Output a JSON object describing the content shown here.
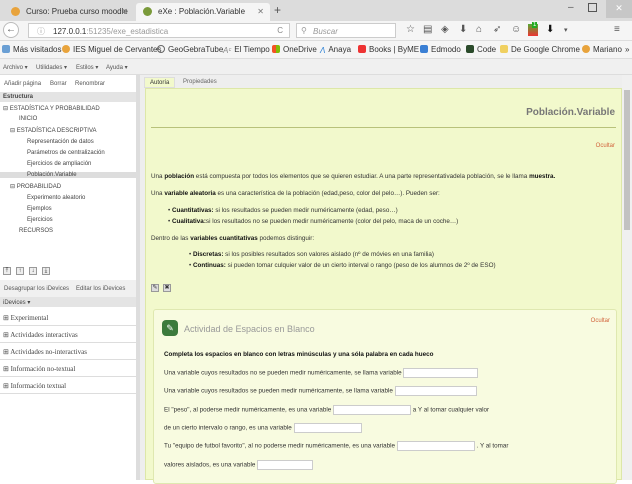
{
  "browser": {
    "tabs": [
      {
        "label": "Curso: Prueba curso moodle",
        "active": false
      },
      {
        "label": "eXe : Población.Variable",
        "active": true
      }
    ],
    "url_host": "127.0.0.1",
    "url_rest": ":51235/exe_estadistica",
    "search_placeholder": "Buscar",
    "badge_count": "1",
    "bookmarks": [
      "Más visitados",
      "IES Miguel de Cervantes",
      "GeoGebraTube",
      "El Tiempo",
      "OneDrive",
      "Anaya",
      "Books | ByME",
      "Edmodo",
      "Code",
      "De Google Chrome",
      "Mariano"
    ],
    "overflow": "»"
  },
  "menu": [
    "Archivo ▾",
    "Utilidades ▾",
    "Estilos ▾",
    "Ayuda ▾"
  ],
  "left": {
    "toolbar": [
      "Añadir página",
      "Borrar",
      "Renombrar"
    ],
    "structure_title": "Estructura",
    "tree": [
      {
        "label": "ESTADÍSTICA Y PROBABILIDAD",
        "level": 0,
        "toggle": "⊟"
      },
      {
        "label": "INICIO",
        "level": 1
      },
      {
        "label": "ESTADÍSTICA DESCRIPTIVA",
        "level": 1,
        "toggle": "⊟"
      },
      {
        "label": "Representación de datos",
        "level": 2
      },
      {
        "label": "Parámetros de centralización",
        "level": 2
      },
      {
        "label": "Ejercicios de ampliación",
        "level": 2
      },
      {
        "label": "Población.Variable",
        "level": 2,
        "selected": true
      },
      {
        "label": "PROBABILIDAD",
        "level": 1,
        "toggle": "⊟"
      },
      {
        "label": "Experimento aleatorio",
        "level": 2
      },
      {
        "label": "Ejemplos",
        "level": 2
      },
      {
        "label": "Ejercicios",
        "level": 2
      },
      {
        "label": "RECURSOS",
        "level": 1
      }
    ],
    "idevice_actions": [
      "Desagrupar los iDevices",
      "Editar los iDevices"
    ],
    "idevices_title": "iDevices ▾",
    "idevice_groups": [
      "Experimental",
      "Actividades interactivas",
      "Actividades no-interactivas",
      "Información no-textual",
      "Información textual"
    ]
  },
  "main": {
    "tabs": [
      "Autoría",
      "Propiedades"
    ],
    "page_title": "Población.Variable",
    "hide": "Ocultar",
    "p1": {
      "a": "Una ",
      "b": "población",
      "c": " está compuesta por todos los elementos que se quieren estudiar. A una parte representativadela población, se le llama ",
      "d": "muestra."
    },
    "p2": {
      "a": "Una ",
      "b": "variable aleatoria",
      "c": " es una característica de la población (edad,peso, color del pelo…). Pueden ser:"
    },
    "list1": [
      {
        "b": "Cuantitativas:",
        "t": " si los resultados se pueden medir numéricamente (edad, peso…)"
      },
      {
        "b": "Cualitativa:",
        "t": "si los resultados no se pueden medir numéricamente (color del pelo, maca de un coche…)"
      }
    ],
    "p3": {
      "a": "Dentro de las ",
      "b": "variables cuantitativas",
      "c": " podemos distinguir:"
    },
    "list2": [
      {
        "b": "Discretas:",
        "t": "  si los posibles resultados son valores aislado (nº de móvies en una familia)"
      },
      {
        "b": "Continuas:",
        "t": " si pueden tomar culquier valor de un cierto interval o rango (peso de los alumnos de 2º de ESO)"
      }
    ],
    "activity": {
      "title": "Actividad de Espacios en Blanco",
      "hide": "Ocultar",
      "instructions": "Completa los espacios en blanco con letras minúsculas y una sóla palabra en cada hueco",
      "lines": [
        {
          "a": "Una variable cuyos resultados no se pueden medir numéricamente, se llama variable",
          "b": ""
        },
        {
          "a": "Una variable cuyos resultados se pueden medir numéricamente, se llama variable",
          "b": ""
        },
        {
          "a": "El \"peso\", al poderse medir numéricamente, es una variable",
          "b": "a  Y al tomar cualquier valor"
        },
        {
          "a": "de un cierto intervalo o rango, es una variable",
          "b": ""
        },
        {
          "a": "Tu \"equipo de futbol favorito\", al no poderse medir numéricamente, es una variable",
          "b": ". Y al tomar"
        },
        {
          "a": "valores aislados, es una variable",
          "b": ""
        }
      ]
    }
  }
}
